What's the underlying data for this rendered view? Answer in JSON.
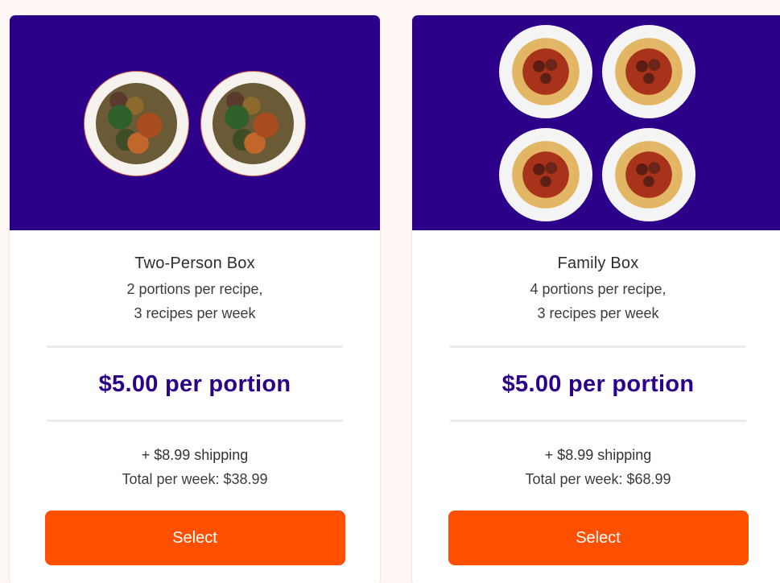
{
  "plans": [
    {
      "title": "Two-Person Box",
      "portions_line": "2 portions per recipe,",
      "recipes_line": "3 recipes per week",
      "price": "$5.00 per portion",
      "shipping": "+ $8.99 shipping",
      "total": "Total per week: $38.99",
      "button_label": "Select",
      "image": "two-plates-chicken-image"
    },
    {
      "title": "Family Box",
      "portions_line": "4 portions per recipe,",
      "recipes_line": "3 recipes per week",
      "price": "$5.00 per portion",
      "shipping": "+ $8.99 shipping",
      "total": "Total per week: $68.99",
      "button_label": "Select",
      "image": "four-plates-spaghetti-image"
    }
  ],
  "colors": {
    "hero_background": "#2c0088",
    "price_text": "#2c0088",
    "button": "#ff4f00",
    "page_background": "#fff7f3"
  }
}
